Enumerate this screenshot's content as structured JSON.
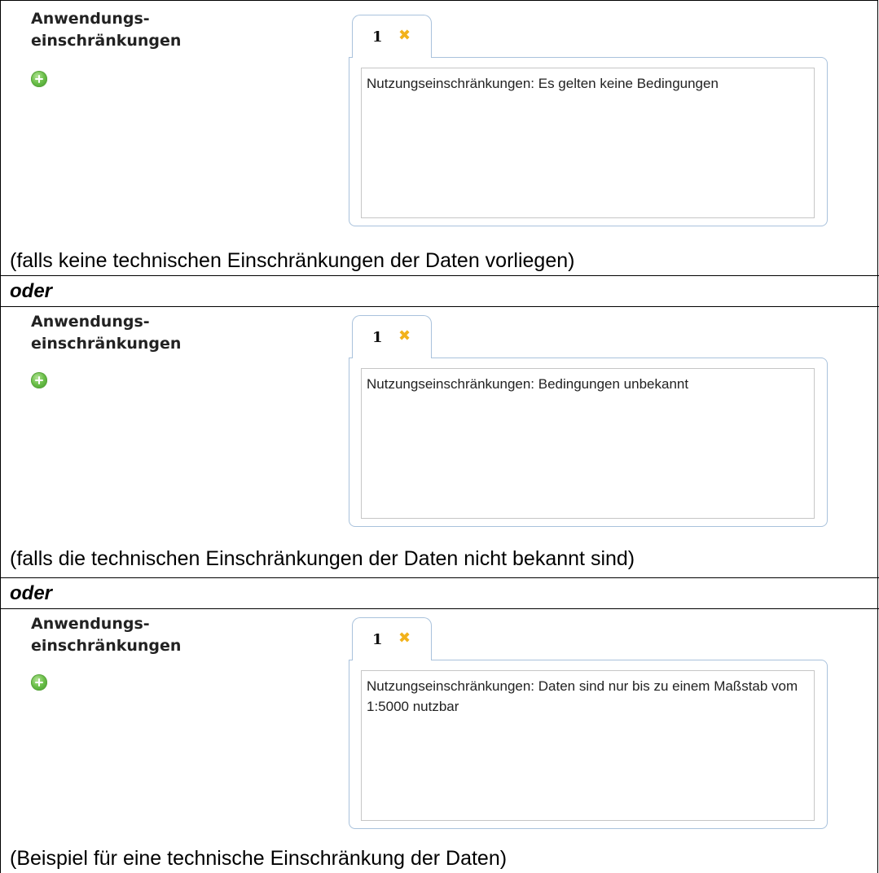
{
  "field_label_line1": "Anwendungs-",
  "field_label_line2": "einschränkungen",
  "add_icon": "plus-circle-icon",
  "close_icon": "close-x-icon",
  "separator_text": "oder",
  "sections": [
    {
      "tab_label": "1",
      "text_value": "Nutzungseinschränkungen: Es gelten keine Bedingungen",
      "caption": "(falls keine technischen Einschränkungen der Daten vorliegen)"
    },
    {
      "tab_label": "1",
      "text_value": "Nutzungseinschränkungen: Bedingungen unbekannt",
      "caption": "(falls die technischen Einschränkungen der Daten nicht bekannt sind)"
    },
    {
      "tab_label": "1",
      "text_value": "Nutzungseinschränkungen: Daten sind nur bis zu einem Maßstab vom 1:5000 nutzbar",
      "caption": "(Beispiel für eine technische Einschränkung der Daten)"
    }
  ],
  "colors": {
    "tab_border": "#a9c2dc",
    "close_x": "#f2b21b",
    "add_icon": "#6cc04a"
  }
}
